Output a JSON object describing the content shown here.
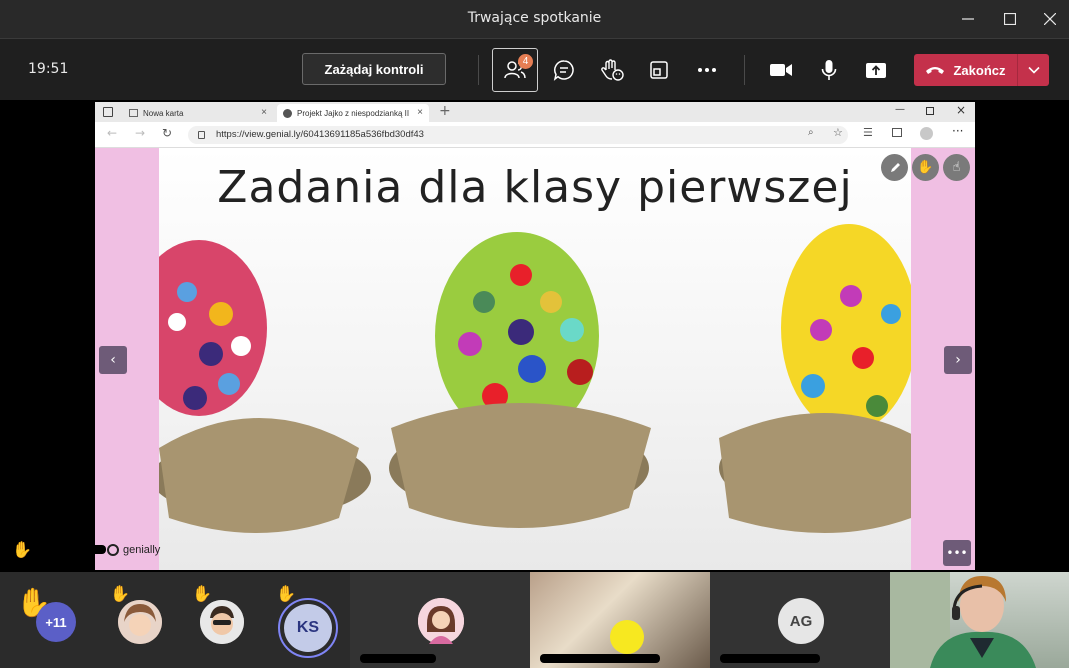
{
  "window": {
    "title": "Trwające spotkanie"
  },
  "toolbar": {
    "time": "19:51",
    "request_control": "Zażądaj kontroli",
    "participants_count": "4",
    "end_label": "Zakończ"
  },
  "browser": {
    "tabs": [
      {
        "label": "Nowa karta"
      },
      {
        "label": "Projekt Jajko z niespodzianką II ..."
      }
    ],
    "url": "https://view.genial.ly/60413691185a536fbd30df43"
  },
  "slide": {
    "title": "Zadania dla klasy pierwszej",
    "brand": "genially"
  },
  "participants": {
    "overflow": "+11",
    "tiles": [
      {
        "initials": "KS"
      },
      {
        "initials": "AG"
      }
    ]
  },
  "colors": {
    "accent": "#c4314b",
    "badge": "#e67e54",
    "slide_frame": "#f0bfe3",
    "genially_button": "#6e5b78"
  }
}
